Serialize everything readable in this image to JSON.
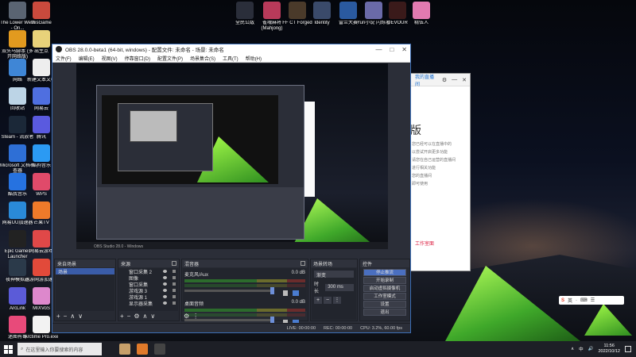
{
  "desktop": {
    "icons": [
      {
        "label": "The Lower West - On...",
        "color": "#5a6472"
      },
      {
        "label": "thisGame",
        "color": "#c94a3d"
      },
      {
        "label": "双头马脚本 (多开网络版)",
        "color": "#e29a1f"
      },
      {
        "label": "出生点",
        "color": "#e8d27a"
      },
      {
        "label": "网络",
        "color": "#3f86d6"
      },
      {
        "label": "新建文本文档",
        "color": "#eeeeee"
      },
      {
        "label": "回收站",
        "color": "#bcd4e6"
      },
      {
        "label": "网易云",
        "color": "#4f6fe0"
      },
      {
        "label": "Steam - 流放者",
        "color": "#1b2838"
      },
      {
        "label": "腾讯",
        "color": "#5a5adf"
      },
      {
        "label": "Microsoft 文档检查器",
        "color": "#2e6fd6"
      },
      {
        "label": "酷狗音乐",
        "color": "#2b9af3"
      },
      {
        "label": "酷我音乐",
        "color": "#2672e0"
      },
      {
        "label": "WPS",
        "color": "#e04a6a"
      },
      {
        "label": "网易UU加速器",
        "color": "#2a8ad8"
      },
      {
        "label": "芒果TV",
        "color": "#ee7a2a"
      },
      {
        "label": "Epic Games Launcher",
        "color": "#222222"
      },
      {
        "label": "网易云游戏",
        "color": "#e04848"
      },
      {
        "label": "夜神模拟器",
        "color": "#2b3a4a"
      },
      {
        "label": "迅游网游加速器",
        "color": "#e24a3a"
      },
      {
        "label": "ArcLink",
        "color": "#5b5bd8"
      },
      {
        "label": "MIXVoS",
        "color": "#dd88cc"
      },
      {
        "label": "迷图有毒",
        "color": "#e84a7a"
      },
      {
        "label": "Arctime Pro.exe",
        "color": "#f2f2f2"
      }
    ],
    "top_icons": [
      {
        "label": "全民公敌",
        "color": "#2a2e3a"
      },
      {
        "label": "雀魂麻将 (Mahjong)",
        "color": "#b83a5a"
      },
      {
        "label": "FF CT Forged",
        "color": "#4a3a2a"
      },
      {
        "label": "Identity",
        "color": "#3a4a6a"
      },
      {
        "label": "雷兰大赛",
        "color": "#2a5aa0"
      },
      {
        "label": "Yuri小说 闪烁者",
        "color": "#6a6aa8"
      },
      {
        "label": "DEVOUR",
        "color": "#3a1a1a"
      },
      {
        "label": "精伍人",
        "color": "#e27ab0"
      }
    ]
  },
  "background_window": {
    "link_text": "我的直播间",
    "heading": "版",
    "lines": [
      "您已经可以在直播中的",
      "以尝试开启更多功能",
      "请您在自己运营的直播间",
      "进行相关功能",
      "您的直播间",
      "即可使用"
    ],
    "red_text": "工作室面"
  },
  "obs": {
    "title": "OBS 28.0.0-beta1 (64-bit, windows) - 配置文件: 未命名 - 场景: 未命名",
    "window_buttons": [
      "—",
      "□",
      "✕"
    ],
    "menu": [
      "文件(F)",
      "编辑(E)",
      "视图(V)",
      "停靠窗口(D)",
      "配置文件(P)",
      "场景集合(S)",
      "工具(T)",
      "帮助(H)"
    ],
    "mini_taskbar_text": "OBS Studio 28.0 - Windows",
    "docks": {
      "scenes": {
        "title": "来自场景",
        "items": [
          "场景"
        ],
        "footer": [
          "+",
          "−",
          "∧",
          "∨"
        ]
      },
      "sources": {
        "title": "来源",
        "items": [
          "窗口采集 2",
          "图像",
          "窗口采集",
          "游戏源 3",
          "游戏源 1",
          "显示器采集"
        ],
        "footer": [
          "+",
          "−",
          "⚙",
          "∧",
          "∨"
        ]
      },
      "mixer": {
        "title": "混音器",
        "channels": [
          {
            "name": "麦克风/Aux",
            "db": "0.0 dB"
          },
          {
            "name": "桌面音频",
            "db": "0.0 dB"
          }
        ],
        "footer": [
          "⚙",
          "⋮"
        ]
      },
      "transitions": {
        "title": "场景转场",
        "selected": "渐变",
        "duration_label": "时长",
        "duration": "300 ms",
        "buttons": [
          "+",
          "−",
          "⋮"
        ]
      },
      "controls": {
        "title": "控件",
        "buttons": [
          "停止推流",
          "开始录制",
          "启动虚拟摄像机",
          "工作室模式",
          "设置",
          "退出"
        ]
      }
    },
    "status": {
      "live": "LIVE: 00:00:00",
      "rec": "REC: 00:00:00",
      "cpu": "CPU: 3.2%, 60.00 fps"
    }
  },
  "ime": {
    "label": "英",
    "icons": [
      "·",
      "⌨",
      "☰"
    ]
  },
  "taskbar": {
    "search_placeholder": "在这里输入你要搜索的内容",
    "app_colors": [
      "#c7a06a",
      "#e07a2a",
      "#444444"
    ],
    "clock_time": "11:56",
    "clock_date": "2022/10/12",
    "tray_indicators": [
      "∧",
      "中",
      "🔊"
    ]
  }
}
